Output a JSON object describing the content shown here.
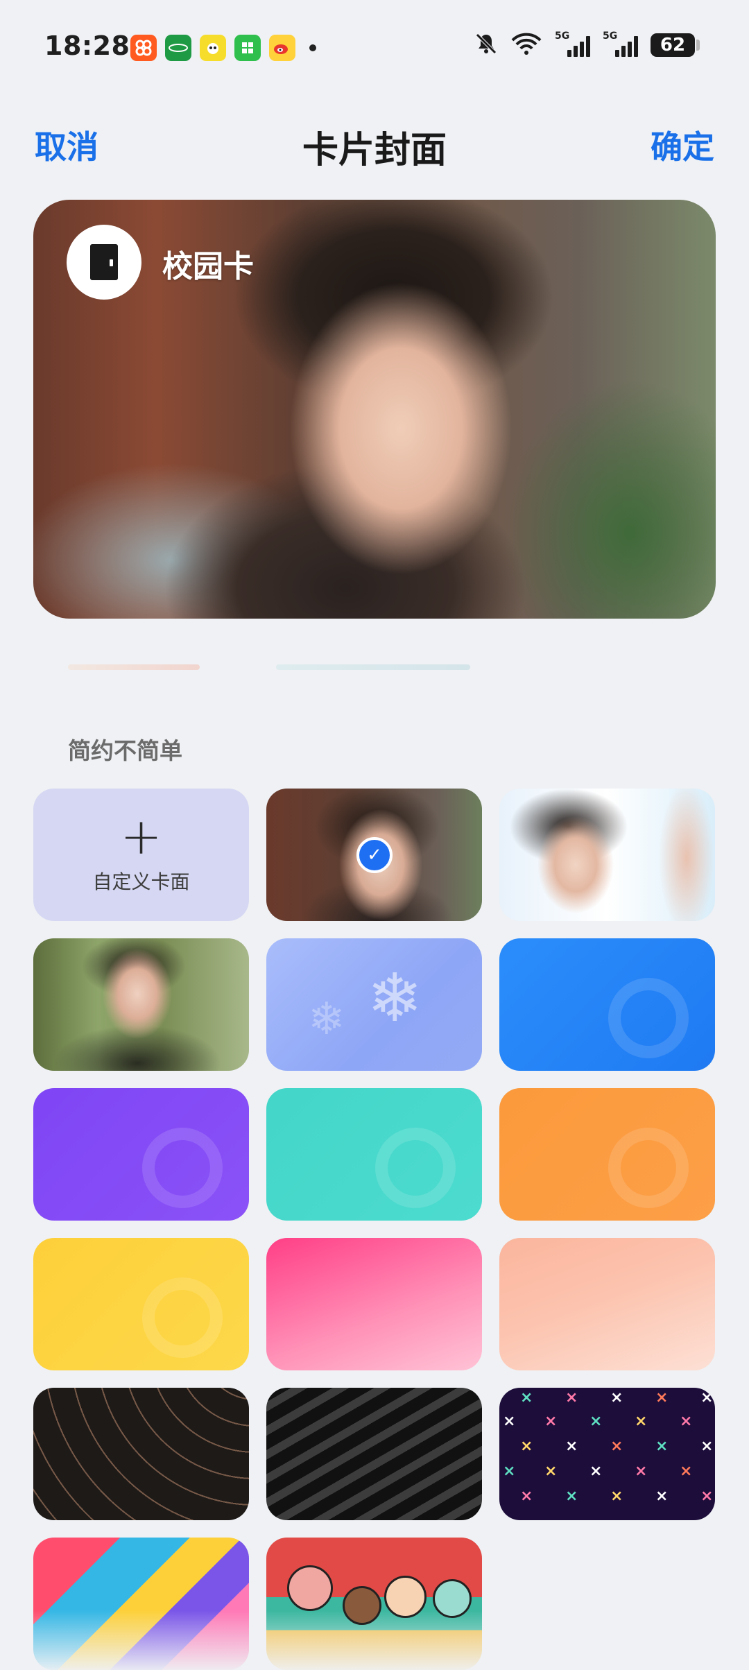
{
  "status_bar": {
    "time": "18:28",
    "app_icons": [
      "taobao-icon",
      "oppo-store-icon",
      "app-yellow-icon",
      "app-green-icon",
      "weibo-icon"
    ],
    "network_1": "5G",
    "network_2": "5G",
    "battery": "62"
  },
  "nav": {
    "cancel": "取消",
    "title": "卡片封面",
    "confirm": "确定"
  },
  "preview": {
    "card_name": "校园卡"
  },
  "section": {
    "title": "简约不简单"
  },
  "custom_cover": {
    "label": "自定义卡面"
  },
  "covers": [
    {
      "name": "custom-cover-tile"
    },
    {
      "name": "cover-photo-1",
      "selected": true
    },
    {
      "name": "cover-photo-2"
    },
    {
      "name": "cover-photo-3"
    },
    {
      "name": "cover-snowflake"
    },
    {
      "name": "cover-blue"
    },
    {
      "name": "cover-purple"
    },
    {
      "name": "cover-teal"
    },
    {
      "name": "cover-orange"
    },
    {
      "name": "cover-yellow"
    },
    {
      "name": "cover-pink-waves"
    },
    {
      "name": "cover-peach-waves"
    },
    {
      "name": "cover-dark-lines"
    },
    {
      "name": "cover-zebra"
    },
    {
      "name": "cover-x-pattern"
    },
    {
      "name": "cover-blocks"
    },
    {
      "name": "cover-cartoon"
    }
  ],
  "colors": {
    "accent": "#1a70e8",
    "selected_check": "#1f6ff2",
    "background": "#eff1f4"
  }
}
